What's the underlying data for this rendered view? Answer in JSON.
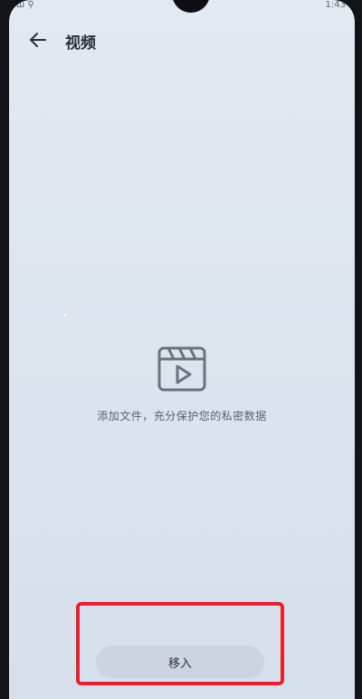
{
  "status_bar": {
    "time": "1:43",
    "left_glyphs": "ш  ⚲"
  },
  "header": {
    "title": "视频",
    "back_icon": "arrow-left-icon"
  },
  "empty_state": {
    "icon": "video-play-icon",
    "message": "添加文件，充分保护您的私密数据"
  },
  "actions": {
    "move_in_label": "移入"
  },
  "colors": {
    "screen_bg": "#dde5ef",
    "text_primary": "#2a2f37",
    "text_secondary": "#5a626d",
    "button_bg": "#cbd4e0",
    "highlight": "#e8202a"
  }
}
